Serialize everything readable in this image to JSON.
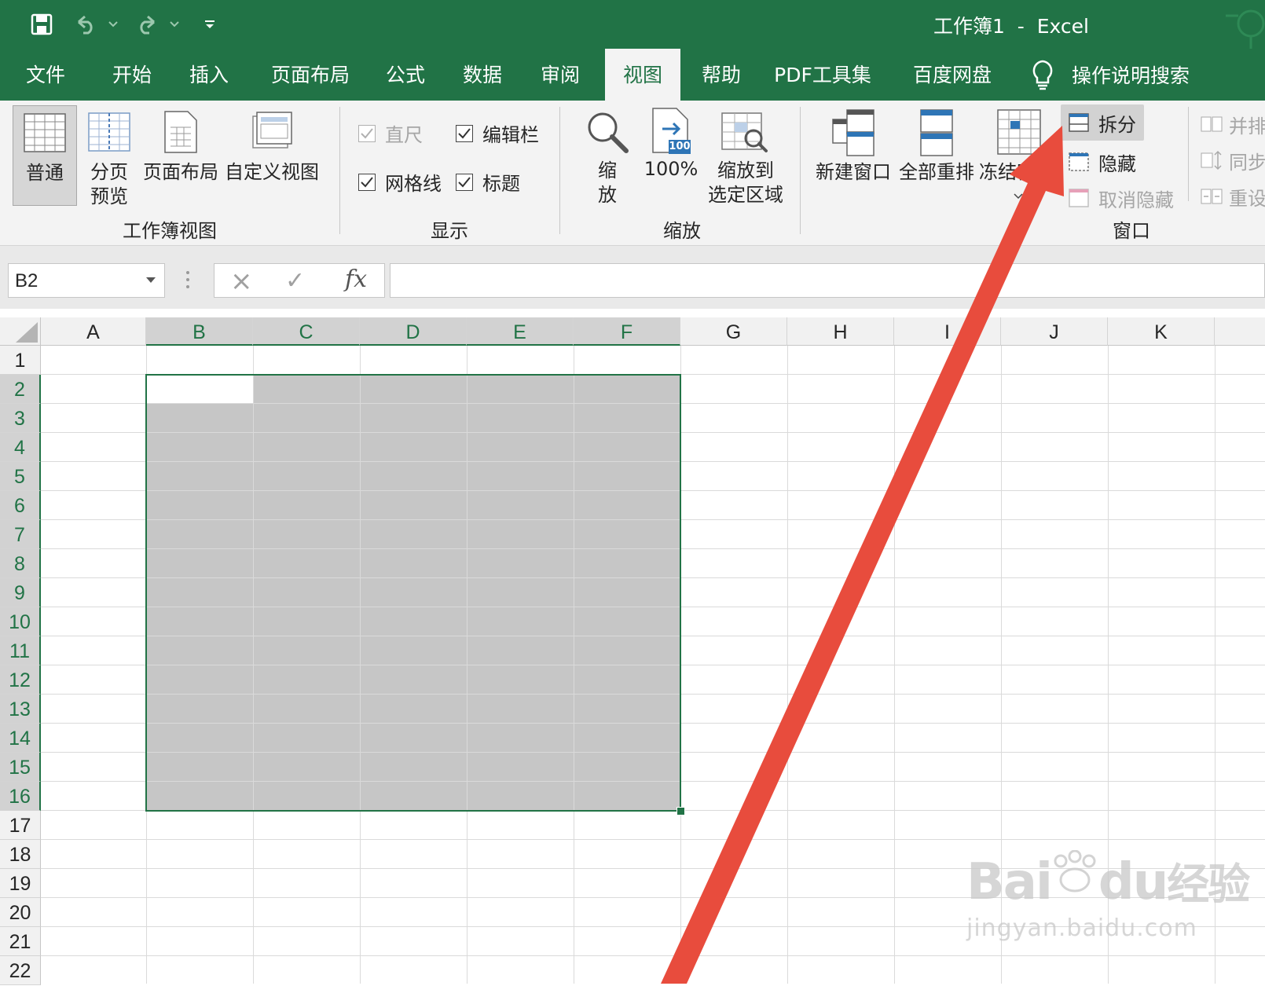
{
  "window": {
    "title": "工作簿1  -  Excel"
  },
  "quick_access": {
    "save": "save-icon",
    "undo": "undo-icon",
    "redo": "redo-icon",
    "customize": "customize-icon"
  },
  "tabs": [
    {
      "label": "文件"
    },
    {
      "label": "开始"
    },
    {
      "label": "插入"
    },
    {
      "label": "页面布局"
    },
    {
      "label": "公式"
    },
    {
      "label": "数据"
    },
    {
      "label": "审阅"
    },
    {
      "label": "视图"
    },
    {
      "label": "帮助"
    },
    {
      "label": "PDF工具集"
    },
    {
      "label": "百度网盘"
    }
  ],
  "active_tab": "视图",
  "search": {
    "label": "操作说明搜索"
  },
  "ribbon": {
    "workbook_views": {
      "group_label": "工作簿视图",
      "normal": "普通",
      "page_break_line1": "分页",
      "page_break_line2": "预览",
      "page_layout": "页面布局",
      "custom_views": "自定义视图"
    },
    "show": {
      "group_label": "显示",
      "ruler": "直尺",
      "formula_bar": "编辑栏",
      "gridlines": "网格线",
      "headings": "标题"
    },
    "zoom": {
      "group_label": "缩放",
      "zoom_line1": "缩",
      "zoom_line2": "放",
      "zoom_100": "100%",
      "zoom_100_badge": "100",
      "zoom_selection_line1": "缩放到",
      "zoom_selection_line2": "选定区域"
    },
    "window": {
      "group_label": "窗口",
      "new_window": "新建窗口",
      "arrange_all": "全部重排",
      "freeze_panes": "冻结窗",
      "split": "拆分",
      "hide": "隐藏",
      "unhide": "取消隐藏",
      "side_by_side": "并排",
      "sync_scroll": "同步",
      "reset_position": "重设"
    }
  },
  "formula_bar": {
    "name_box": "B2",
    "cancel": "×",
    "enter": "✓",
    "fx": "fx",
    "content": ""
  },
  "sheet": {
    "columns": [
      "A",
      "B",
      "C",
      "D",
      "E",
      "F",
      "G",
      "H",
      "I",
      "J",
      "K"
    ],
    "selected_columns": [
      "B",
      "C",
      "D",
      "E",
      "F"
    ],
    "rows": [
      "1",
      "2",
      "3",
      "4",
      "5",
      "6",
      "7",
      "8",
      "9",
      "10",
      "11",
      "12",
      "13",
      "14",
      "15",
      "16",
      "17",
      "18",
      "19",
      "20",
      "21",
      "22"
    ],
    "selected_rows": [
      "2",
      "3",
      "4",
      "5",
      "6",
      "7",
      "8",
      "9",
      "10",
      "11",
      "12",
      "13",
      "14",
      "15",
      "16"
    ],
    "selection": "B2:F16",
    "active_cell": "B2"
  },
  "watermark": {
    "brand": "Bai",
    "brand2": "du",
    "brand3": "经验",
    "url": "jingyan.baidu.com"
  },
  "colors": {
    "excel_green": "#217346",
    "arrow_red": "#e84c3d",
    "selection_fill": "#c6c6c6"
  }
}
